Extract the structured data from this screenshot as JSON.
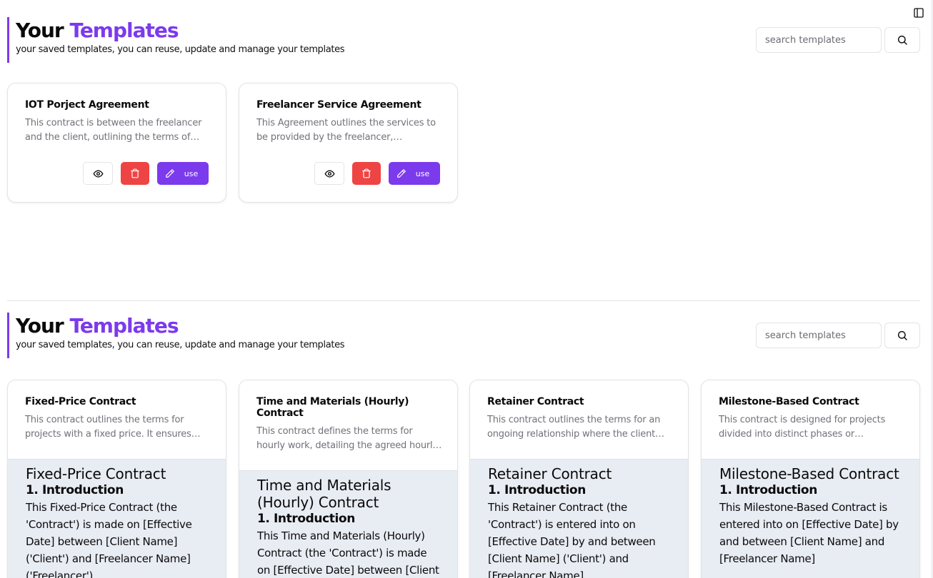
{
  "sidebar_toggle_icon": "panel-left-icon",
  "sections": [
    {
      "title_plain": "Your",
      "title_accent": "Templates",
      "subtitle": "your saved templates, you can reuse, update and manage your templates",
      "search": {
        "placeholder": "search templates",
        "value": "",
        "icon": "search-icon"
      },
      "cards": [
        {
          "title": "IOT Porject Agreement",
          "description": "This contract is between the freelancer and the client, outlining the terms of…",
          "actions": {
            "view_icon": "eye-icon",
            "delete_icon": "trash-icon",
            "use_icon": "pencil-icon",
            "use_label": "use"
          }
        },
        {
          "title": "Freelancer Service Agreement",
          "description": "This Agreement outlines the services to be provided by the freelancer,…",
          "actions": {
            "view_icon": "eye-icon",
            "delete_icon": "trash-icon",
            "use_icon": "pencil-icon",
            "use_label": "use"
          }
        }
      ]
    },
    {
      "title_plain": "Your",
      "title_accent": "Templates",
      "subtitle": "your saved templates, you can reuse, update and manage your templates",
      "search": {
        "placeholder": "search templates",
        "value": "",
        "icon": "search-icon"
      },
      "cards": [
        {
          "title": "Fixed-Price Contract",
          "description": "This contract outlines the terms for projects with a fixed price. It ensures…",
          "preview": {
            "title": "Fixed-Price Contract",
            "heading": "1. Introduction",
            "body": "This Fixed-Price Contract (the 'Contract') is made on [Effective Date] between [Client Name] ('Client') and [Freelancer Name] ('Freelancer')."
          }
        },
        {
          "title": "Time and Materials (Hourly) Contract",
          "description": "This contract defines the terms for hourly work, detailing the agreed hourl…",
          "preview": {
            "title": "Time and Materials (Hourly) Contract",
            "heading": "1. Introduction",
            "body": "This Time and Materials (Hourly) Contract (the 'Contract') is made on [Effective Date] between [Client"
          }
        },
        {
          "title": "Retainer Contract",
          "description": "This contract outlines the terms for an ongoing relationship where the client…",
          "preview": {
            "title": "Retainer Contract",
            "heading": "1. Introduction",
            "body": "This Retainer Contract (the 'Contract') is entered into on [Effective Date] by and between [Client Name] ('Client') and [Freelancer Name]"
          }
        },
        {
          "title": "Milestone-Based Contract",
          "description": "This contract is designed for projects divided into distinct phases or…",
          "preview": {
            "title": "Milestone-Based Contract",
            "heading": "1. Introduction",
            "body": "This Milestone-Based Contract is entered into on [Effective Date] by and between [Client Name] and [Freelancer Name]"
          }
        }
      ]
    }
  ]
}
